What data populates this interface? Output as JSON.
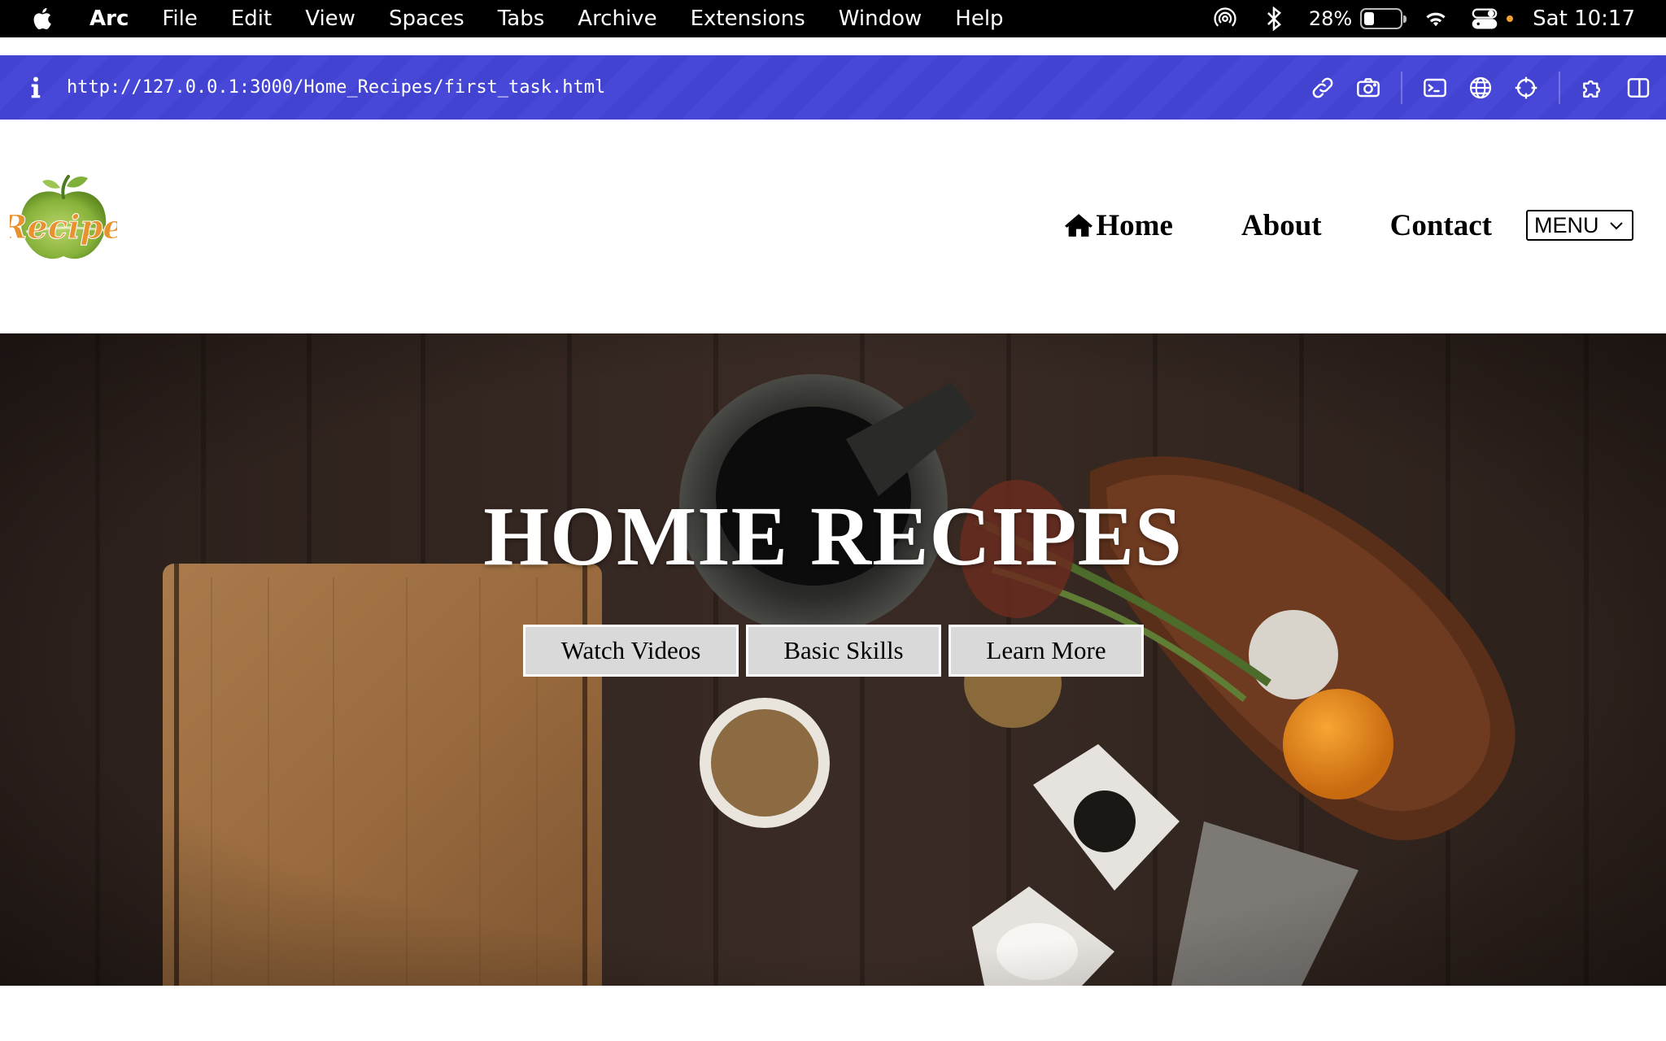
{
  "menubar": {
    "app_name": "Arc",
    "items": [
      "File",
      "Edit",
      "View",
      "Spaces",
      "Tabs",
      "Archive",
      "Extensions",
      "Window",
      "Help"
    ],
    "battery_percent": "28%",
    "battery_level": 0.28,
    "clock": "Sat 10:17"
  },
  "urlbar": {
    "url": "http://127.0.0.1:3000/Home_Recipes/first_task.html",
    "accent_color": "#4545d5"
  },
  "site": {
    "logo_text": "Recipe",
    "nav": {
      "home": "Home",
      "about": "About",
      "contact": "Contact",
      "menu_select": "MENU"
    }
  },
  "hero": {
    "title": "HOMIE RECIPES",
    "buttons": [
      "Watch Videos",
      "Basic Skills",
      "Learn More"
    ]
  }
}
